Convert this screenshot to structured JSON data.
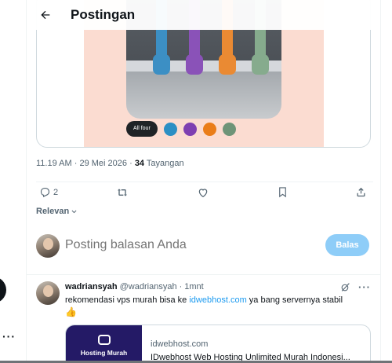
{
  "header": {
    "title": "Postingan"
  },
  "media": {
    "filter_all": "All four",
    "swatches": [
      "#2c8fc4",
      "#7e3fb1",
      "#ea7d19",
      "#6e9478"
    ]
  },
  "post_meta": {
    "time": "11.19 AM",
    "date": "29 Mei 2026",
    "separator": "·",
    "views_count": "34",
    "views_label": "Tayangan"
  },
  "actions": {
    "replies_count": "2"
  },
  "sort": {
    "label": "Relevan"
  },
  "composer": {
    "placeholder": "Posting balasan Anda",
    "reply_button": "Balas"
  },
  "reply": {
    "name": "wadriansyah",
    "handle": "@wadriansyah",
    "separator": "·",
    "time": "1mnt",
    "text_before": "rekomendasi vps murah bisa ke ",
    "link": "idwebhost.com",
    "text_after": " ya bang servernya stabil",
    "emoji": "👍",
    "card": {
      "image_caption": "Hosting Murah",
      "domain": "idwebhost.com",
      "title": "IDwebhost Web Hosting Unlimited Murah Indonesi..."
    }
  },
  "colors": {
    "accent": "#1d9bf0",
    "reply_button_bg": "#8ecdf8",
    "media_bg": "#fbdcd1"
  }
}
